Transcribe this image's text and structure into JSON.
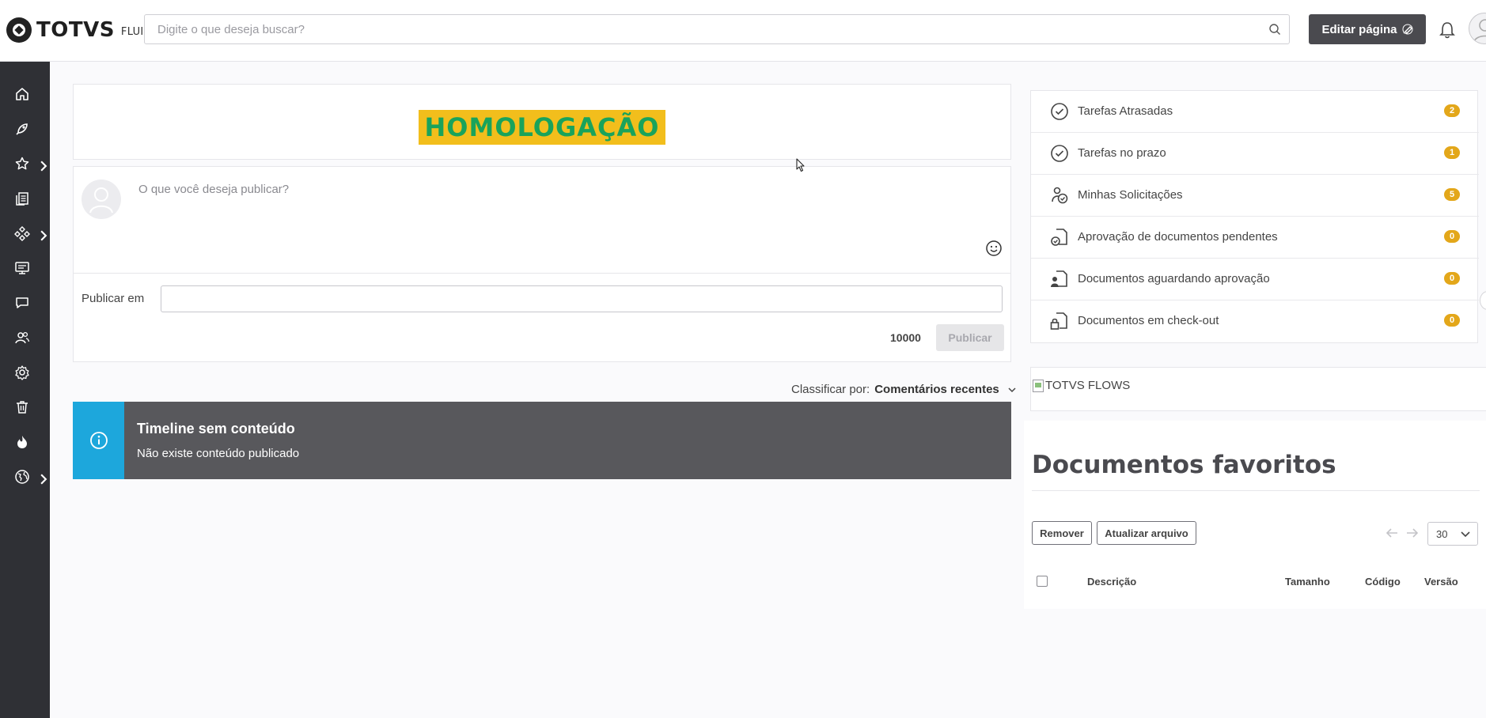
{
  "header": {
    "brand": "TOTVS",
    "brand_sub": "FLUIG",
    "search_placeholder": "Digite o que deseja buscar?",
    "edit_page_label": "Editar página"
  },
  "sidebar": {
    "items": [
      {
        "icon": "home-icon"
      },
      {
        "icon": "rocket-icon"
      },
      {
        "icon": "star-icon",
        "has_submenu": true
      },
      {
        "icon": "documents-icon"
      },
      {
        "icon": "workflow-icon",
        "has_submenu": true
      },
      {
        "icon": "presentation-icon"
      },
      {
        "icon": "chat-icon"
      },
      {
        "icon": "users-icon"
      },
      {
        "icon": "gear-icon"
      },
      {
        "icon": "trash-icon"
      },
      {
        "icon": "flame-icon"
      },
      {
        "icon": "globe-icon",
        "has_submenu": true
      }
    ]
  },
  "banner": {
    "text": "HOMOLOGAÇÃO",
    "bg_color": "#f2be1c",
    "text_color": "#19a35b"
  },
  "post": {
    "placeholder": "O que você deseja publicar?",
    "publish_in_label": "Publicar em",
    "publish_in_value": "",
    "char_count": "10000",
    "publish_button": "Publicar"
  },
  "timeline": {
    "sort_label": "Classificar por:",
    "sort_value": "Comentários recentes",
    "empty_title": "Timeline sem conteúdo",
    "empty_message": "Não existe conteúdo publicado"
  },
  "tasks": [
    {
      "label": "Tarefas Atrasadas",
      "count": "2",
      "icon": "clock-check-icon"
    },
    {
      "label": "Tarefas no prazo",
      "count": "1",
      "icon": "clock-check-icon"
    },
    {
      "label": "Minhas Solicitações",
      "count": "5",
      "icon": "user-clock-icon"
    },
    {
      "label": "Aprovação de documentos pendentes",
      "count": "0",
      "icon": "document-clock-icon"
    },
    {
      "label": "Documentos aguardando aprovação",
      "count": "0",
      "icon": "document-user-icon"
    },
    {
      "label": "Documentos em check-out",
      "count": "0",
      "icon": "document-lock-icon"
    }
  ],
  "flows": {
    "alt_text": "TOTVS FLOWS"
  },
  "favorites": {
    "title": "Documentos favoritos",
    "remove_button": "Remover",
    "update_button": "Atualizar arquivo",
    "page_size": "30",
    "columns": [
      "Descrição",
      "Tamanho",
      "Código",
      "Versão"
    ]
  },
  "colors": {
    "sidebar_bg": "#2f3035",
    "badge": "#e3a71a",
    "notice_accent": "#1da7dc",
    "notice_bg": "#58585c"
  }
}
